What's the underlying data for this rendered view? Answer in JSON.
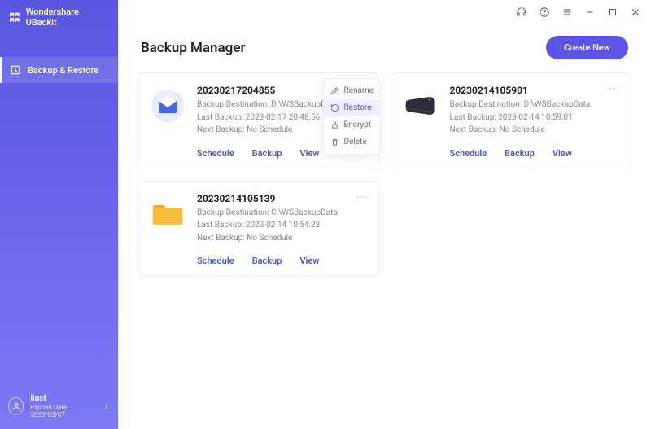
{
  "app": {
    "brand": "Wondershare UBackit"
  },
  "sidebar": {
    "tab_label": "Backup & Restore",
    "user": {
      "name": "liusf",
      "expired": "Expired Date: 2023/03/07"
    }
  },
  "header": {
    "title": "Backup Manager",
    "create": "Create New"
  },
  "labels": {
    "dest_prefix": "Backup Destination: ",
    "last_prefix": "Last Backup: ",
    "next_prefix": "Next Backup: ",
    "schedule": "Schedule",
    "backup": "Backup",
    "view": "View"
  },
  "context_menu": {
    "rename": "Rename",
    "restore": "Restore",
    "encrypt": "Encrypt",
    "delete": "Delete"
  },
  "cards": [
    {
      "title": "20230217204855",
      "dest": "D:\\WSBackupData",
      "last": "2023-02-17 20:48:56",
      "next": "No Schedule",
      "icon": "mail"
    },
    {
      "title": "20230214105901",
      "dest": "D:\\WSBackupData",
      "last": "2023-02-14 10:59:01",
      "next": "No Schedule",
      "icon": "disk"
    },
    {
      "title": "20230214105139",
      "dest": "C:\\WSBackupData",
      "last": "2023-02-14 10:54:23",
      "next": "No Schedule",
      "icon": "folder"
    }
  ]
}
